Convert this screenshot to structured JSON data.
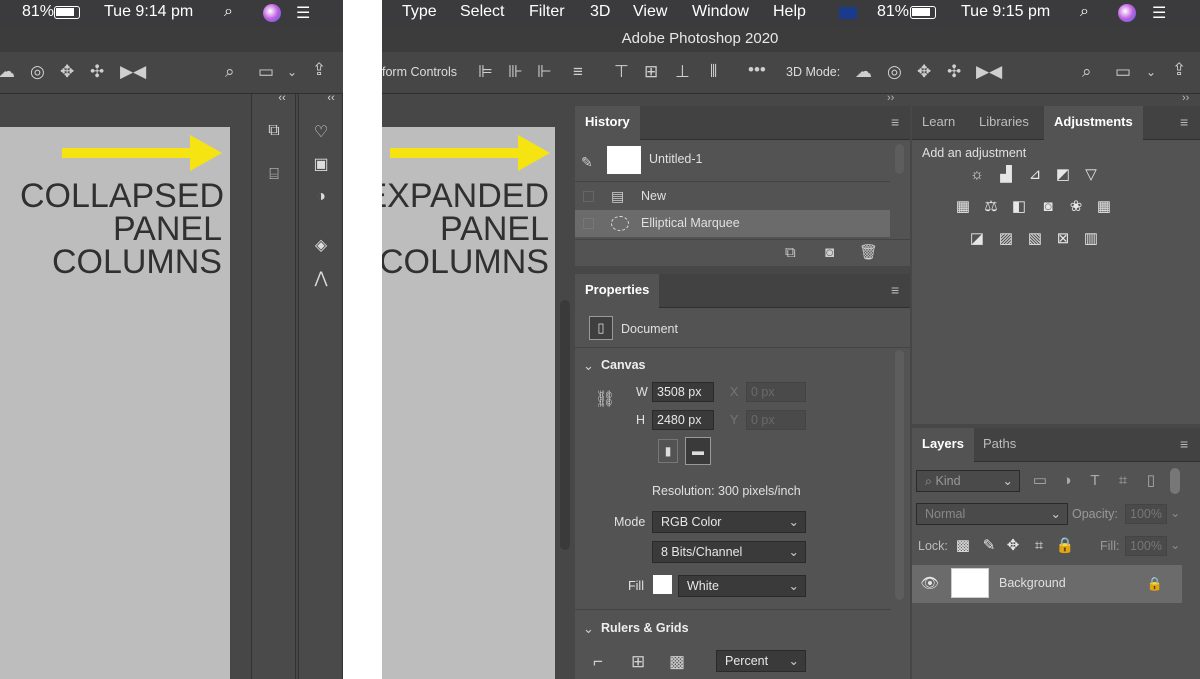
{
  "left_screen": {
    "menubar": {
      "battery": "81%",
      "time": "Tue 9:14 pm"
    },
    "annotation": {
      "line1": "COLLAPSED",
      "line2": "PANEL",
      "line3": "COLUMNS"
    }
  },
  "right_screen": {
    "menubar": {
      "items": [
        "Type",
        "Select",
        "Filter",
        "3D",
        "View",
        "Window",
        "Help"
      ],
      "battery": "81%",
      "time": "Tue 9:15 pm"
    },
    "app_title": "Adobe Photoshop 2020",
    "options_bar": {
      "transform_controls": "form Controls",
      "three_d_mode": "3D Mode:"
    },
    "annotation": {
      "line1": "EXPANDED",
      "line2": "PANEL",
      "line3": "COLUMNS"
    },
    "history": {
      "tab": "History",
      "snapshot": "Untitled-1",
      "states": [
        "New",
        "Elliptical Marquee"
      ]
    },
    "properties": {
      "tab": "Properties",
      "doc_label": "Document",
      "canvas_section": "Canvas",
      "w_label": "W",
      "w_value": "3508 px",
      "h_label": "H",
      "h_value": "2480 px",
      "x_label": "X",
      "x_placeholder": "0 px",
      "y_label": "Y",
      "y_placeholder": "0 px",
      "resolution": "Resolution: 300 pixels/inch",
      "mode_label": "Mode",
      "mode_value": "RGB Color",
      "depth_value": "8 Bits/Channel",
      "fill_label": "Fill",
      "fill_value": "White",
      "rulers_section": "Rulers & Grids",
      "units_value": "Percent"
    },
    "adjustments": {
      "tabs": [
        "Learn",
        "Libraries",
        "Adjustments"
      ],
      "active_tab": "Adjustments",
      "hint": "Add an adjustment"
    },
    "layers": {
      "tabs": [
        "Layers",
        "Paths"
      ],
      "kind_placeholder": "Kind",
      "blend_mode": "Normal",
      "opacity_label": "Opacity:",
      "opacity_value": "100%",
      "lock_label": "Lock:",
      "fill_label": "Fill:",
      "fill_value": "100%",
      "layer_name": "Background"
    }
  },
  "colors": {
    "arrow": "#f5e411",
    "panel": "#535353",
    "canvas": "#bdbdbd"
  }
}
